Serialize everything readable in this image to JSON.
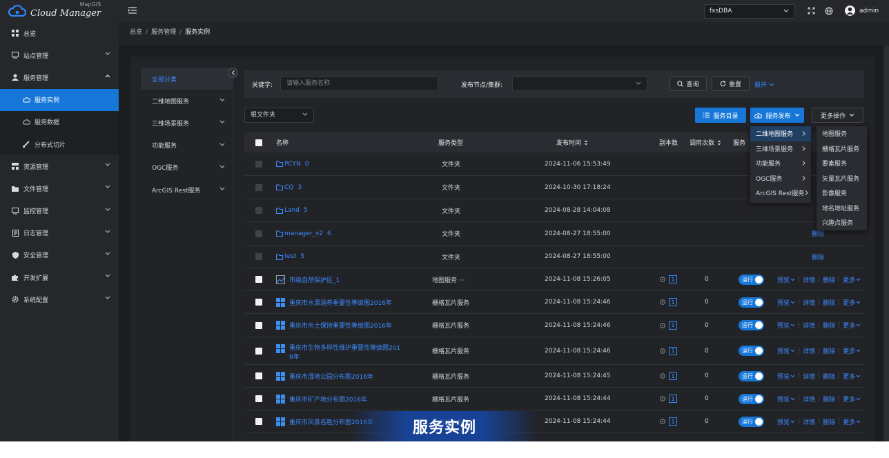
{
  "app": {
    "logo_text": "Cloud Manager",
    "logo_sup": "MapGIS"
  },
  "sidebar": {
    "items": [
      {
        "label": "总览",
        "icon": "grid-icon"
      },
      {
        "label": "站点管理",
        "icon": "monitor-icon"
      },
      {
        "label": "服务管理",
        "icon": "user-service-icon"
      },
      {
        "label": "服务实例",
        "icon": "cloud-icon"
      },
      {
        "label": "服务数据",
        "icon": "cloud-data-icon"
      },
      {
        "label": "分布式切片",
        "icon": "slice-icon"
      },
      {
        "label": "资源管理",
        "icon": "resource-icon"
      },
      {
        "label": "文件管理",
        "icon": "folder-icon"
      },
      {
        "label": "监控管理",
        "icon": "monitor-icon"
      },
      {
        "label": "日志管理",
        "icon": "log-icon"
      },
      {
        "label": "安全管理",
        "icon": "shield-icon"
      },
      {
        "label": "开发扩展",
        "icon": "puzzle-icon"
      },
      {
        "label": "系统配置",
        "icon": "gear-icon"
      }
    ]
  },
  "header": {
    "node_select": "fxsDBA",
    "username": "admin"
  },
  "breadcrumb": {
    "items": [
      "总览",
      "服务管理",
      "服务实例"
    ]
  },
  "categories": [
    "全部分类",
    "二维地图服务",
    "三维场景服务",
    "功能服务",
    "OGC服务",
    "ArcGIS Rest服务"
  ],
  "filter": {
    "keyword_label": "关键字:",
    "keyword_placeholder": "请输入服务名称",
    "node_label": "发布节点/集群:",
    "query": "查询",
    "reset": "重置",
    "expand": "展开"
  },
  "toolbar": {
    "folder": "根文件夹",
    "catalog": "服务目录",
    "publish": "服务发布",
    "more": "更多操作"
  },
  "table": {
    "headers": {
      "name": "名称",
      "type": "服务类型",
      "time": "发布时间",
      "copies": "副本数",
      "calls": "调用次数",
      "status": "服务"
    },
    "folders": [
      {
        "name": "PCYN",
        "count": "0",
        "type": "文件夹",
        "time": "2024-11-06 15:53:49",
        "op": ""
      },
      {
        "name": "CQ",
        "count": "3",
        "type": "文件夹",
        "time": "2024-10-30 17:18:24",
        "op": ""
      },
      {
        "name": "Land",
        "count": "5",
        "type": "文件夹",
        "time": "2024-08-28 14:04:08",
        "op": ""
      },
      {
        "name": "manager_v2",
        "count": "6",
        "type": "文件夹",
        "time": "2024-08-27 18:55:00",
        "op": "删除"
      },
      {
        "name": "test",
        "count": "5",
        "type": "文件夹",
        "time": "2024-08-27 18:55:00",
        "op": "删除"
      }
    ],
    "services": [
      {
        "name": "市级自然保护区_1",
        "name2": "",
        "type": "地图服务 ···",
        "time": "2024-11-08 15:26:05",
        "copies": "1",
        "calls": "0",
        "status": "运行"
      },
      {
        "name": "重庆市水源涵养重要性等级图2016年",
        "name2": "",
        "type": "栅格瓦片服务",
        "time": "2024-11-08 15:24:46",
        "copies": "1",
        "calls": "0",
        "status": "运行"
      },
      {
        "name": "重庆市水土保持重要性等级图2016年",
        "name2": "",
        "type": "栅格瓦片服务",
        "time": "2024-11-08 15:24:46",
        "copies": "1",
        "calls": "0",
        "status": "运行"
      },
      {
        "name": "重庆市生物多样性维护重要性等级图201",
        "name2": "6年",
        "type": "栅格瓦片服务",
        "time": "2024-11-08 15:24:46",
        "copies": "1",
        "calls": "0",
        "status": "运行"
      },
      {
        "name": "重庆市湿地公园分布图2016年",
        "name2": "",
        "type": "栅格瓦片服务",
        "time": "2024-11-08 15:24:45",
        "copies": "1",
        "calls": "0",
        "status": "运行"
      },
      {
        "name": "重庆市矿产地分布图2016年",
        "name2": "",
        "type": "栅格瓦片服务",
        "time": "2024-11-08 15:24:44",
        "copies": "1",
        "calls": "0",
        "status": "运行"
      },
      {
        "name": "重庆市风景名胜分布图2016年",
        "name2": "",
        "type": "栅格瓦片服务",
        "time": "2024-11-08 15:24:44",
        "copies": "1",
        "calls": "0",
        "status": "运行"
      }
    ],
    "ops": {
      "preview": "预览",
      "detail": "详情",
      "delete": "删除",
      "more": "更多"
    }
  },
  "publish_menu": {
    "level1": [
      "二维地图服务",
      "三维场景服务",
      "功能服务",
      "OGC服务",
      "ArcGIS Rest服务"
    ],
    "level2": [
      "地图服务",
      "栅格瓦片服务",
      "要素服务",
      "矢量瓦片服务",
      "影像服务",
      "地名地址服务",
      "兴趣点服务"
    ]
  },
  "banner": "服务实例",
  "colors": {
    "accent": "#1677d9",
    "link": "#3d8bff",
    "sidebar_bg": "#25272b",
    "page_bg": "#1b1c1e"
  }
}
